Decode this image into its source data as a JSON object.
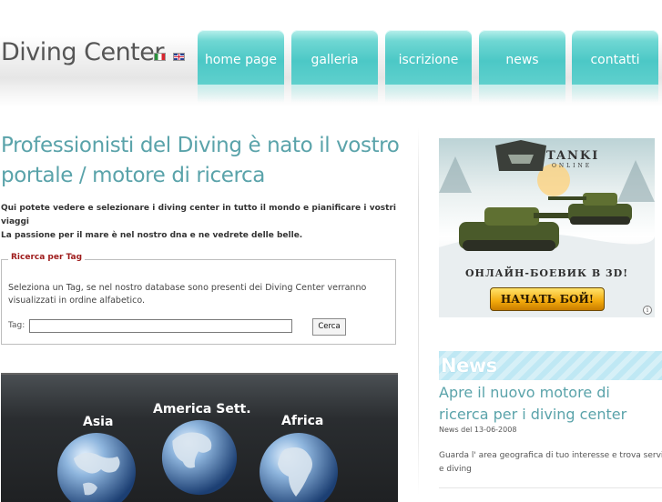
{
  "header": {
    "logo": "Diving Center",
    "languages": [
      "italiano",
      "english"
    ],
    "nav": [
      {
        "label": "home page"
      },
      {
        "label": "galleria"
      },
      {
        "label": "iscrizione"
      },
      {
        "label": "news"
      },
      {
        "label": "contatti"
      }
    ]
  },
  "main": {
    "headline": "Professionisti del Diving è nato il vostro portale / motore di ricerca",
    "intro_line1": "Qui potete vedere e selezionare i diving center in tutto il mondo e pianificare i vostri viaggi",
    "intro_line2": "La passione per il mare è nel nostro dna e ne vedrete delle belle.",
    "search": {
      "legend": "Ricerca per Tag",
      "description": "Seleziona un Tag, se nel nostro database sono presenti dei Diving Center verranno visualizzati in ordine alfabetico.",
      "tag_label": "Tag:",
      "tag_value": "",
      "button_label": "Cerca"
    },
    "map": {
      "regions": [
        "Asia",
        "America Sett.",
        "Africa"
      ]
    }
  },
  "sidebar": {
    "ad": {
      "brand_line1": "TANKI",
      "brand_line2": "ONLINE",
      "slogan": "ОНЛАЙН-БОЕВИК В 3D!",
      "button": "НАЧАТЬ БОЙ!",
      "info": "i"
    },
    "news": {
      "heading": "News",
      "title": "Apre il nuovo motore di ricerca per i diving center",
      "date": "News del 13-06-2008",
      "body": "Guarda l' area geografica di tuo interesse e trova servizi e diving"
    }
  },
  "colors": {
    "accent_teal": "#5aa3aa",
    "nav_tab": "#4cc8c6",
    "legend_red": "#9e1b1b",
    "news_header": "#bfe8f4"
  }
}
